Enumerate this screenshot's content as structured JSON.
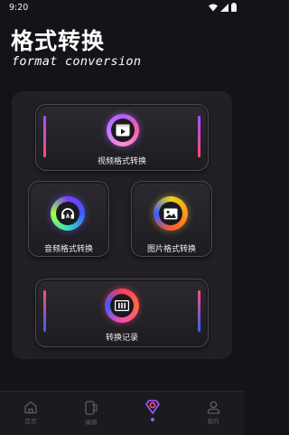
{
  "status_bar": {
    "time": "9:20"
  },
  "header": {
    "title": "格式转换",
    "subtitle": "format conversion"
  },
  "cards": {
    "video": {
      "label": "视频格式转换"
    },
    "audio": {
      "label": "音频格式转换"
    },
    "image": {
      "label": "图片格式转换"
    },
    "history": {
      "label": "转换记录"
    }
  },
  "nav": {
    "home": {
      "label": "首页",
      "icon": "home-icon"
    },
    "edit": {
      "label": "编辑",
      "icon": "phone-edit-icon"
    },
    "convert": {
      "icon": "convert-icon",
      "active": true
    },
    "mine": {
      "label": "我的",
      "icon": "person-icon"
    }
  },
  "colors": {
    "background": "#15131a",
    "accent_purple": "#a64dff",
    "accent_pink": "#ff4b7d",
    "accent_yellow": "#e7d21c",
    "accent_blue": "#3d5bff"
  }
}
